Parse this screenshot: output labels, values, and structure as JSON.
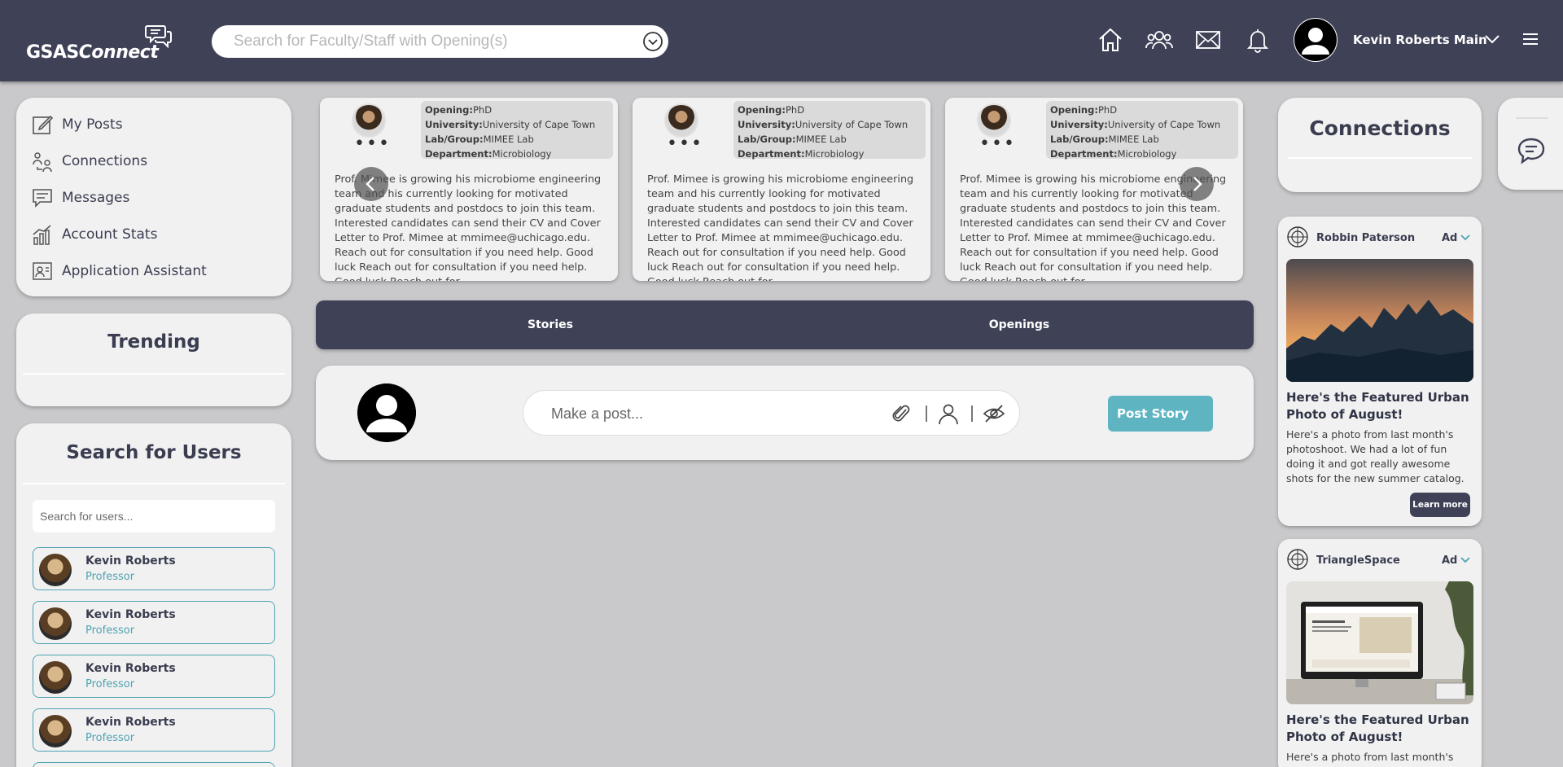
{
  "header": {
    "logo_text_regular": "GSAS",
    "logo_text_italic": "Connect",
    "search_placeholder": "Search for Faculty/Staff with Opening(s)",
    "user_name": "Kevin Roberts Main"
  },
  "sidebar": {
    "items": [
      {
        "label": "My Posts",
        "icon": "edit-icon"
      },
      {
        "label": "Connections",
        "icon": "connections-icon"
      },
      {
        "label": "Messages",
        "icon": "message-icon"
      },
      {
        "label": "Account Stats",
        "icon": "stats-icon"
      },
      {
        "label": "Application Assistant",
        "icon": "assistant-icon"
      }
    ]
  },
  "trending": {
    "title": "Trending"
  },
  "user_search": {
    "title": "Search for Users",
    "placeholder": "Search for users...",
    "users": [
      {
        "name": "Kevin Roberts",
        "role": "Professor"
      },
      {
        "name": "Kevin Roberts",
        "role": "Professor"
      },
      {
        "name": "Kevin Roberts",
        "role": "Professor"
      },
      {
        "name": "Kevin Roberts",
        "role": "Professor"
      }
    ]
  },
  "openings": [
    {
      "opening_label": "Opening:",
      "opening": "PhD",
      "university_label": "University:",
      "university": "University of Cape Town",
      "lab_label": "Lab/Group:",
      "lab": "MIMEE Lab",
      "department_label": "Department:",
      "department": "Microbiology",
      "dots": "•••",
      "body": "Prof. Mimee is growing his microbiome engineering team and his currently looking for motivated graduate students and postdocs to join this team. Interested candidates can send their CV and Cover Letter to Prof. Mimee at mmimee@uchicago.edu. Reach out for consultation if you need help. Good luck Reach out for consultation if you need help. Good luck Reach out for"
    },
    {
      "opening_label": "Opening:",
      "opening": "PhD",
      "university_label": "University:",
      "university": "University of Cape Town",
      "lab_label": "Lab/Group:",
      "lab": "MIMEE Lab",
      "department_label": "Department:",
      "department": "Microbiology",
      "dots": "•••",
      "body": "Prof. Mimee is growing his microbiome engineering team and his currently looking for motivated graduate students and postdocs to join this team. Interested candidates can send their CV and Cover Letter to Prof. Mimee at mmimee@uchicago.edu. Reach out for consultation if you need help. Good luck Reach out for consultation if you need help. Good luck Reach out for"
    },
    {
      "opening_label": "Opening:",
      "opening": "PhD",
      "university_label": "University:",
      "university": "University of Cape Town",
      "lab_label": "Lab/Group:",
      "lab": "MIMEE Lab",
      "department_label": "Department:",
      "department": "Microbiology",
      "dots": "•••",
      "body": "Prof. Mimee is growing his microbiome engineering team and his currently looking for motivated graduate students and postdocs to join this team. Interested candidates can send their CV and Cover Letter to Prof. Mimee at mmimee@uchicago.edu. Reach out for consultation if you need help. Good luck Reach out for consultation if you need help. Good luck Reach out for"
    }
  ],
  "tabs": [
    {
      "label": "Stories"
    },
    {
      "label": "Openings"
    }
  ],
  "composer": {
    "placeholder": "Make a post...",
    "post_button": "Post Story"
  },
  "connections": {
    "title": "Connections"
  },
  "ads": [
    {
      "brand": "Robbin Paterson",
      "tag": "Ad",
      "title": "Here's the Featured Urban Photo of August!",
      "description": "Here's a photo from last month's photoshoot. We had a lot of fun doing it and got really awesome shots for the new summer catalog.",
      "cta": "Learn more"
    },
    {
      "brand": "TriangleSpace",
      "tag": "Ad",
      "title": "Here's the Featured Urban Photo of August!",
      "description": "Here's a photo from last month's"
    }
  ],
  "colors": {
    "header_bg": "#3f4257",
    "page_bg": "#c9c9cb",
    "card_bg": "#f1f1f2",
    "accent_teal": "#5fb4c2",
    "user_border": "#4fa3b0"
  }
}
